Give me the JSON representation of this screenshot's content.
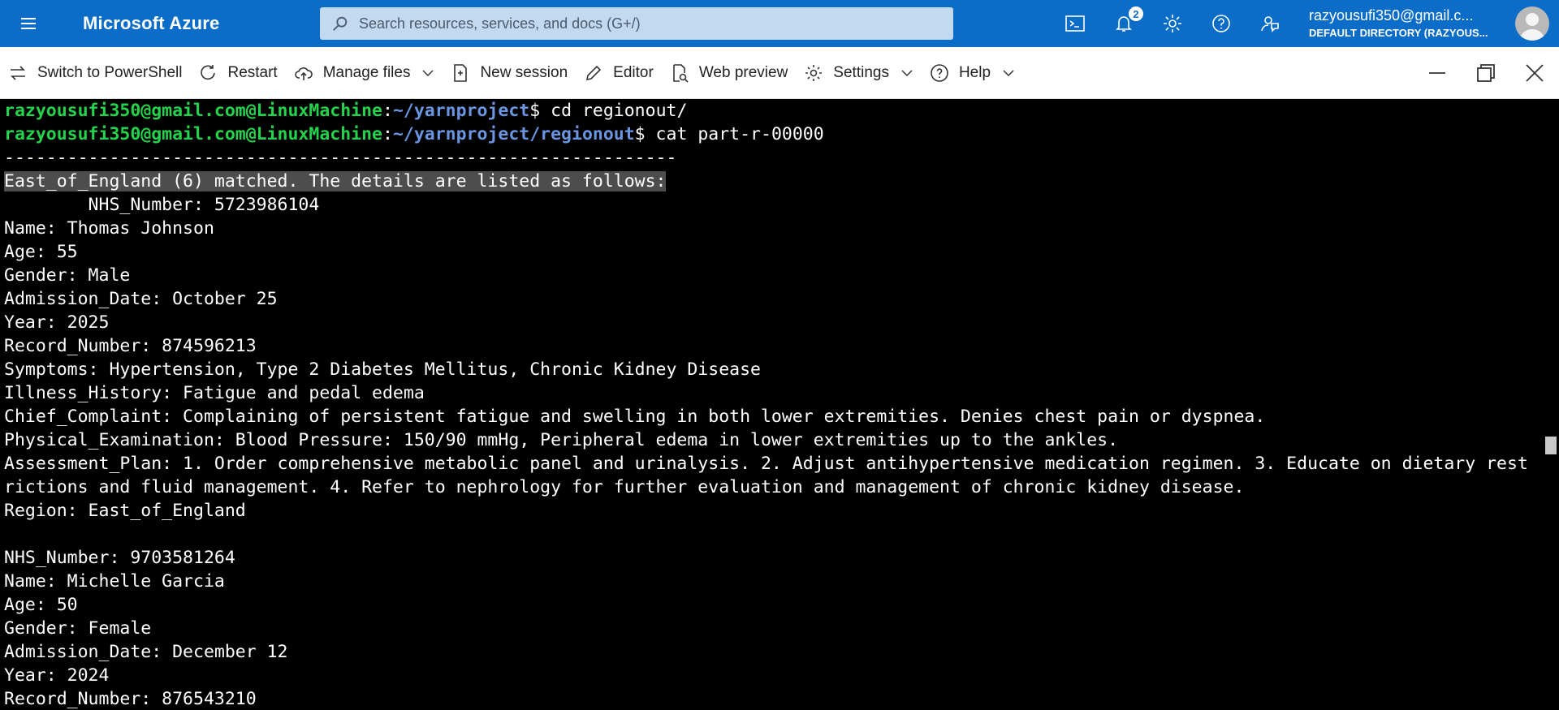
{
  "topbar": {
    "brand": "Microsoft Azure",
    "search_placeholder": "Search resources, services, and docs (G+/)",
    "notification_count": "2",
    "account_email": "razyousufi350@gmail.c...",
    "account_directory": "DEFAULT DIRECTORY (RAZYOUS...",
    "icons": [
      "menu-icon",
      "cloud-shell-icon",
      "bell-icon",
      "gear-icon",
      "help-icon",
      "feedback-icon"
    ],
    "accent": "#0b6dc7"
  },
  "toolbar": {
    "switch_label": "Switch to PowerShell",
    "restart_label": "Restart",
    "manage_files_label": "Manage files",
    "new_session_label": "New session",
    "editor_label": "Editor",
    "web_preview_label": "Web preview",
    "settings_label": "Settings",
    "help_label": "Help"
  },
  "terminal": {
    "prompt_user": "razyousufi350@gmail.com@LinuxMachine",
    "prompt1_path": "~/yarnproject",
    "prompt1_cmd": "$ cd regionout/",
    "prompt2_path": "~/yarnproject/regionout",
    "prompt2_cmd": "$ cat part-r-00000",
    "separator": "----------------------------------------------------------------",
    "header": "East_of_England (6) matched. The details are listed as follows:",
    "lines": [
      "        NHS_Number: 5723986104",
      "Name: Thomas Johnson",
      "Age: 55",
      "Gender: Male",
      "Admission_Date: October 25",
      "Year: 2025",
      "Record_Number: 874596213",
      "Symptoms: Hypertension, Type 2 Diabetes Mellitus, Chronic Kidney Disease",
      "Illness_History: Fatigue and pedal edema",
      "Chief_Complaint: Complaining of persistent fatigue and swelling in both lower extremities. Denies chest pain or dyspnea.",
      "Physical_Examination: Blood Pressure: 150/90 mmHg, Peripheral edema in lower extremities up to the ankles.",
      "Assessment_Plan: 1. Order comprehensive metabolic panel and urinalysis. 2. Adjust antihypertensive medication regimen. 3. Educate on dietary rest",
      "rictions and fluid management. 4. Refer to nephrology for further evaluation and management of chronic kidney disease.",
      "Region: East_of_England",
      "",
      "NHS_Number: 9703581264",
      "Name: Michelle Garcia",
      "Age: 50",
      "Gender: Female",
      "Admission_Date: December 12",
      "Year: 2024",
      "Record_Number: 876543210"
    ],
    "colors": {
      "user": "#25d24c",
      "path": "#6a95e0",
      "text": "#ffffff",
      "background": "#000000"
    }
  }
}
